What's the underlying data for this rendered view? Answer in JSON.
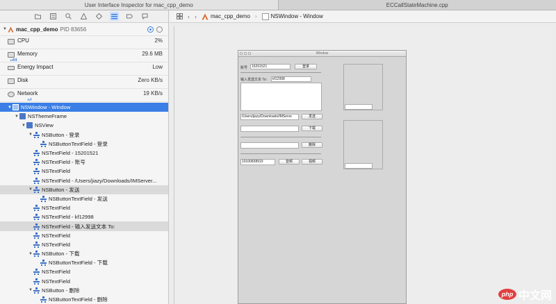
{
  "tabs": [
    {
      "label": "User Interface Inspector for mac_cpp_demo",
      "active": true
    },
    {
      "label": "ECCallStateMachine.cpp",
      "active": false
    }
  ],
  "process": {
    "name": "mac_cpp_demo",
    "pid": "PID 83656"
  },
  "gauges": [
    {
      "label": "CPU",
      "value": "2%"
    },
    {
      "label": "Memory",
      "value": "29.6 MB"
    },
    {
      "label": "Energy Impact",
      "value": "Low"
    },
    {
      "label": "Disk",
      "value": "Zero KB/s"
    },
    {
      "label": "Network",
      "value": "19 KB/s"
    }
  ],
  "tree": [
    {
      "label": "NSWindow - Window",
      "icon": "window-icon",
      "state": "selected",
      "expanded": true
    },
    {
      "label": "NSThemeFrame",
      "icon": "frame-icon",
      "expanded": true
    },
    {
      "label": "NSView",
      "icon": "view-icon",
      "expanded": true
    },
    {
      "label": "NSButton - 登录",
      "icon": "control-icon",
      "expanded": true
    },
    {
      "label": "NSButtonTextField - 登录",
      "icon": "control-icon"
    },
    {
      "label": "NSTextField - 15201521",
      "icon": "control-icon"
    },
    {
      "label": "NSTextField - 账号",
      "icon": "control-icon"
    },
    {
      "label": "NSTextField",
      "icon": "control-icon"
    },
    {
      "label": "NSTextField - /Users/jiazy/Downloads/IMServer...",
      "icon": "control-icon"
    },
    {
      "label": "NSButton - 发送",
      "icon": "control-icon",
      "state": "highlight",
      "expanded": true
    },
    {
      "label": "NSButtonTextField - 发送",
      "icon": "control-icon"
    },
    {
      "label": "NSTextField",
      "icon": "control-icon"
    },
    {
      "label": "NSTextField - kf12998",
      "icon": "control-icon"
    },
    {
      "label": "NSTextField - 输入发送文本 To:",
      "icon": "control-icon",
      "state": "highlight"
    },
    {
      "label": "NSTextField",
      "icon": "control-icon"
    },
    {
      "label": "NSTextField",
      "icon": "control-icon"
    },
    {
      "label": "NSButton - 下载",
      "icon": "control-icon",
      "expanded": true
    },
    {
      "label": "NSButtonTextField - 下载",
      "icon": "control-icon"
    },
    {
      "label": "NSTextField",
      "icon": "control-icon"
    },
    {
      "label": "NSTextField",
      "icon": "control-icon"
    },
    {
      "label": "NSButton - 删除",
      "icon": "control-icon",
      "expanded": true
    },
    {
      "label": "NSButtonTextField - 删除",
      "icon": "control-icon"
    }
  ],
  "jumpbar": {
    "app": "mac_cpp_demo",
    "window": "NSWindow - Window"
  },
  "mockup": {
    "title": "Window",
    "account_label": "账号",
    "account_value": "15201521",
    "login_button": "登录",
    "send_to_label": "输入发送文本 To:",
    "send_to_value": "kf12998",
    "path_value": "/Users/jiazy/Downloads/IMServe",
    "send_button": "发送",
    "download_button": "下载",
    "delete_button": "删除",
    "number_value": "10100838919",
    "btn_a": "音频",
    "btn_b": "视频"
  },
  "watermark": {
    "badge": "php",
    "text": "中文网"
  },
  "colors": {
    "selection": "#3a7ee6",
    "accent": "#4a78c8"
  }
}
